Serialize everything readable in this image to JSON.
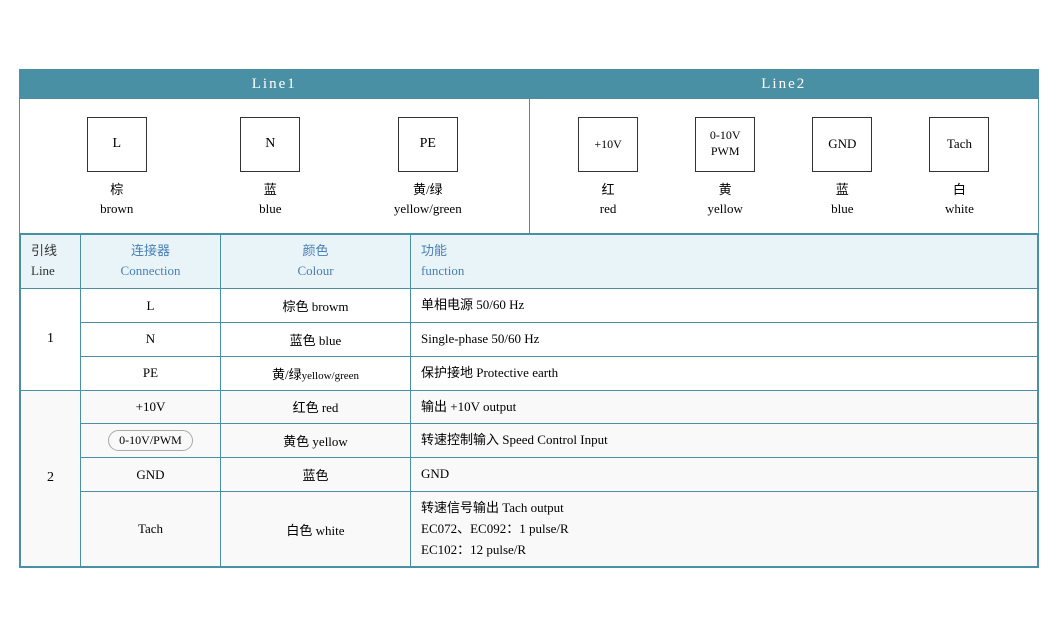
{
  "header": {
    "line1_label": "Line1",
    "line2_label": "Line2"
  },
  "diagram": {
    "line1": {
      "connectors": [
        {
          "label": "L",
          "chinese": "棕",
          "english": "brown"
        },
        {
          "label": "N",
          "chinese": "蓝",
          "english": "blue"
        },
        {
          "label": "PE",
          "chinese": "黄/绿",
          "english": "yellow/green"
        }
      ]
    },
    "line2": {
      "connectors": [
        {
          "label": "+10V",
          "chinese": "红",
          "english": "red"
        },
        {
          "label": "0-10V\nPWM",
          "chinese": "黄",
          "english": "yellow"
        },
        {
          "label": "GND",
          "chinese": "蓝",
          "english": "blue"
        },
        {
          "label": "Tach",
          "chinese": "白",
          "english": "white"
        }
      ]
    }
  },
  "table": {
    "headers": {
      "line_zh": "引线",
      "line_en": "Line",
      "connection_zh": "连接器",
      "connection_en": "Connection",
      "colour_zh": "颜色",
      "colour_en": "Colour",
      "function_zh": "功能",
      "function_en": "function"
    },
    "rows_line1": [
      {
        "line": "1",
        "connection": "L",
        "colour_zh": "棕色",
        "colour_en": "browm",
        "func_zh": "单相电源 50/60 Hz",
        "func_en": ""
      },
      {
        "line": "",
        "connection": "N",
        "colour_zh": "蓝色",
        "colour_en": "blue",
        "func_zh": "",
        "func_en": "Single-phase 50/60 Hz"
      },
      {
        "line": "",
        "connection": "PE",
        "colour_zh": "黄/绿",
        "colour_en": "yellow/green",
        "func_zh": "保护接地 Protective earth",
        "func_en": ""
      }
    ],
    "rows_line2": [
      {
        "connection": "+10V",
        "colour_zh": "红色",
        "colour_en": "red",
        "func": "输出 +10V output",
        "rounded": false
      },
      {
        "connection": "0-10V/PWM",
        "colour_zh": "黄色",
        "colour_en": "yellow",
        "func": "转速控制输入 Speed Control Input",
        "rounded": true
      },
      {
        "connection": "GND",
        "colour_zh": "蓝色",
        "colour_en": "",
        "func": "GND",
        "rounded": false
      },
      {
        "connection": "Tach",
        "colour_zh": "白色",
        "colour_en": "white",
        "func_line1": "转速信号输出 Tach output",
        "func_line2": "EC072、EC092：1 pulse/R",
        "func_line3": "EC102：12 pulse/R",
        "rounded": false
      }
    ]
  }
}
